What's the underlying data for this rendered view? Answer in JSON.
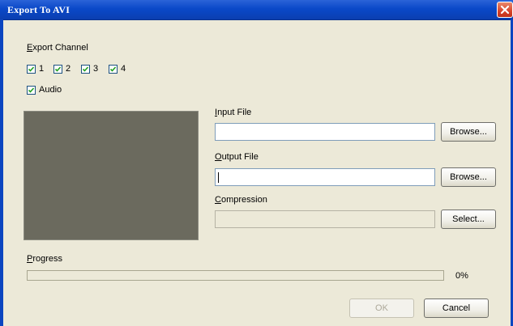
{
  "window": {
    "title": "Export To AVI"
  },
  "export_channel": {
    "label": "Export Channel",
    "channels": [
      {
        "label": "1",
        "checked": true
      },
      {
        "label": "2",
        "checked": true
      },
      {
        "label": "3",
        "checked": true
      },
      {
        "label": "4",
        "checked": true
      }
    ],
    "audio": {
      "label": "Audio",
      "checked": true
    }
  },
  "input_file": {
    "label": "Input File",
    "value": "",
    "browse_label": "Browse..."
  },
  "output_file": {
    "label": "Output File",
    "value": "",
    "browse_label": "Browse..."
  },
  "compression": {
    "label": "Compression",
    "value": "",
    "select_label": "Select..."
  },
  "progress": {
    "label": "Progress",
    "percent_text": "0%",
    "fraction": 0
  },
  "footer": {
    "ok_label": "OK",
    "cancel_label": "Cancel"
  },
  "colors": {
    "titlebar": "#0a48c8",
    "dialog_bg": "#ece9d8",
    "preview_bg": "#6b6a5e"
  }
}
